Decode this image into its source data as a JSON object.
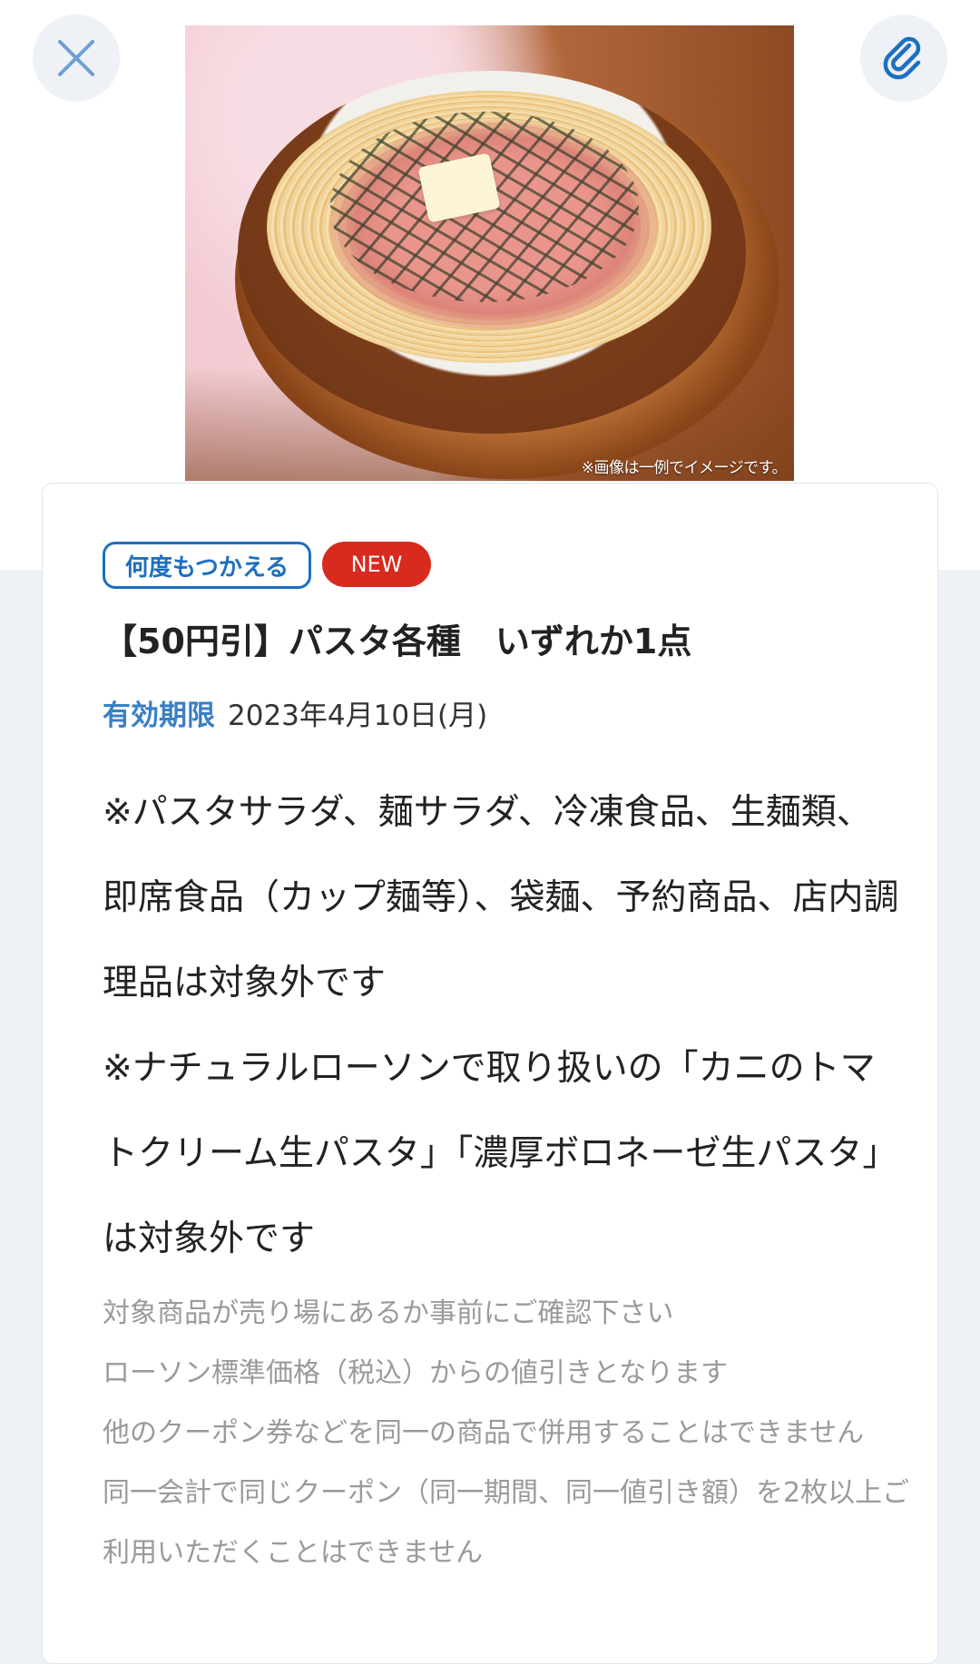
{
  "header": {
    "close_icon": "close-icon",
    "clip_icon": "paperclip-icon",
    "accent_color": "#1c6fc1"
  },
  "image": {
    "caption": "※画像は一例でイメージです。"
  },
  "coupon": {
    "badges": {
      "reuse": "何度もつかえる",
      "new": "NEW",
      "new_color": "#d82a1e"
    },
    "title": "【50円引】パスタ各種　いずれか1点",
    "validity": {
      "label": "有効期限",
      "value": "2023年4月10日(月)"
    },
    "notes": [
      "※パスタサラダ、麺サラダ、冷凍食品、生麺類、即席食品（カップ麺等）、袋麺、予約商品、店内調理品は対象外です",
      "※ナチュラルローソンで取り扱いの「カニのトマトクリーム生パスタ」「濃厚ボロネーゼ生パスタ」は対象外です"
    ],
    "sub_notes": [
      "対象商品が売り場にあるか事前にご確認下さい",
      "ローソン標準価格（税込）からの値引きとなります",
      "他のクーポン券などを同一の商品で併用することはできません",
      "同一会計で同じクーポン（同一期間、同一値引き額）を2枚以上ご利用いただくことはできません"
    ]
  }
}
